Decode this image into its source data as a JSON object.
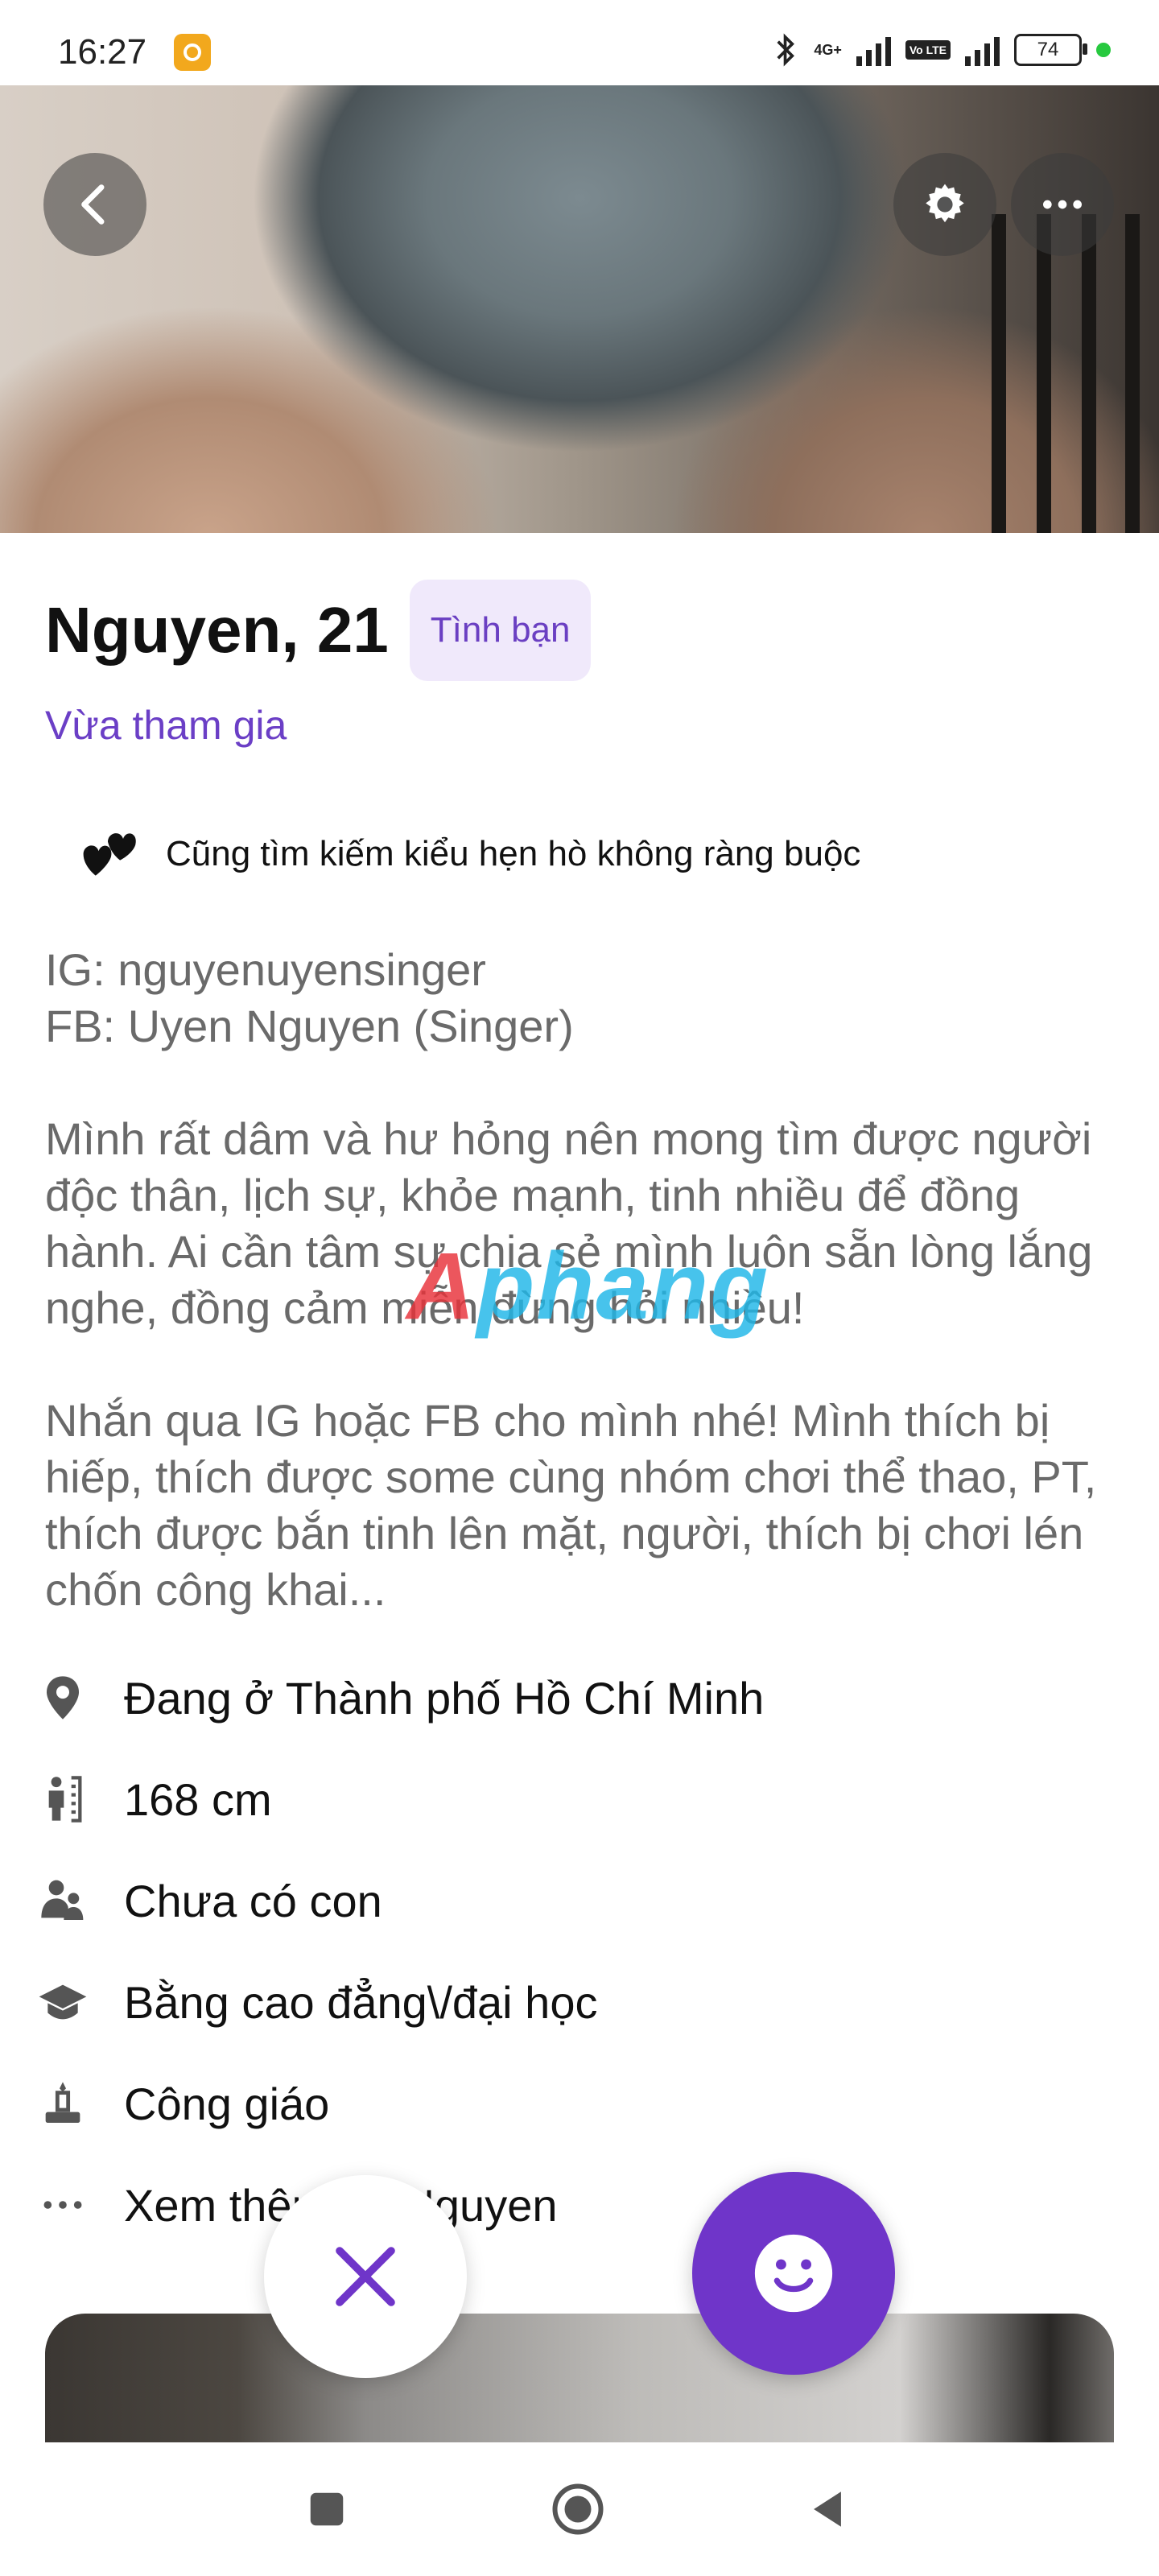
{
  "status_bar": {
    "time": "16:27",
    "network": "4G+",
    "volte": "Vo LTE",
    "battery": "74"
  },
  "hero": {
    "back_icon": "chevron-left-icon",
    "settings_icon": "gear-icon",
    "more_icon": "more-horizontal-icon"
  },
  "profile": {
    "name_age": "Nguyen, 21",
    "intent_tag": "Tình bạn",
    "joined": "Vừa tham gia",
    "also_looking": "Cũng tìm kiếm kiểu hẹn hò không ràng buộc",
    "bio": "IG: nguyenuyensinger\nFB: Uyen Nguyen (Singer)\n\nMình rất dâm và hư hỏng nên mong tìm được người độc thân, lịch sự, khỏe mạnh, tinh nhiều để đồng hành. Ai cần tâm sự chia sẻ mình luôn sẵn lòng lắng nghe, đồng cảm miễn đừng hỏi nhiều!\n\nNhắn qua IG hoặc FB cho mình nhé! Mình thích bị hiếp, thích được some cùng nhóm chơi thể thao, PT, thích được bắn tinh lên mặt, người, thích bị chơi lén chốn công khai...",
    "watermark": "Aphang"
  },
  "details": [
    {
      "icon": "location-pin-icon",
      "text": "Đang ở Thành phố Hồ Chí Minh"
    },
    {
      "icon": "height-icon",
      "text": "168 cm"
    },
    {
      "icon": "children-icon",
      "text": "Chưa có con"
    },
    {
      "icon": "education-cap-icon",
      "text": "Bằng cao đẳng\\/đại học"
    },
    {
      "icon": "religion-icon",
      "text": "Công giáo"
    },
    {
      "icon": "more-dots-icon",
      "text": "Xem thêm về Nguyen"
    }
  ],
  "actions": {
    "pass_icon": "close-icon",
    "like_icon": "smile-icon"
  },
  "colors": {
    "accent": "#6f35c9",
    "accent_text": "#6b3fc6",
    "tag_bg": "#f0e9fb"
  }
}
